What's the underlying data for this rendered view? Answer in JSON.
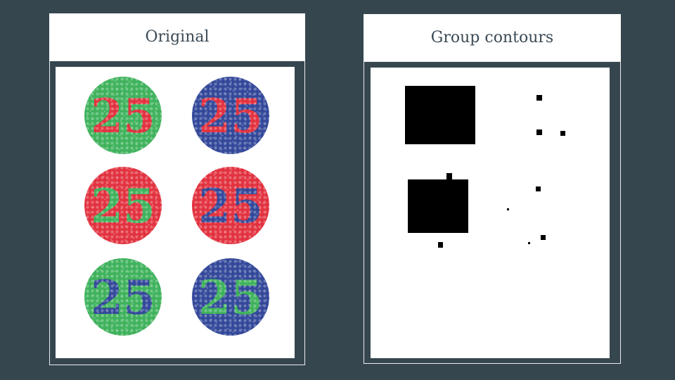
{
  "left_panel": {
    "title": "Original",
    "plates": [
      {
        "text": "25",
        "background_color": "#3fb25c",
        "digit_color": "#e2323f"
      },
      {
        "text": "25",
        "background_color": "#33489a",
        "digit_color": "#e2323f"
      },
      {
        "text": "25",
        "background_color": "#e2323f",
        "digit_color": "#3fb25c"
      },
      {
        "text": "25",
        "background_color": "#e2323f",
        "digit_color": "#33489a"
      },
      {
        "text": "25",
        "background_color": "#3fb25c",
        "digit_color": "#33489a"
      },
      {
        "text": "25",
        "background_color": "#33489a",
        "digit_color": "#3fb25c"
      }
    ]
  },
  "right_panel": {
    "title": "Group contours"
  },
  "colors": {
    "page_background": "#36464f",
    "header_background": "#ffffff",
    "header_text": "#3b4a55",
    "canvas_background": "#ffffff",
    "contour_fill": "#000000"
  }
}
